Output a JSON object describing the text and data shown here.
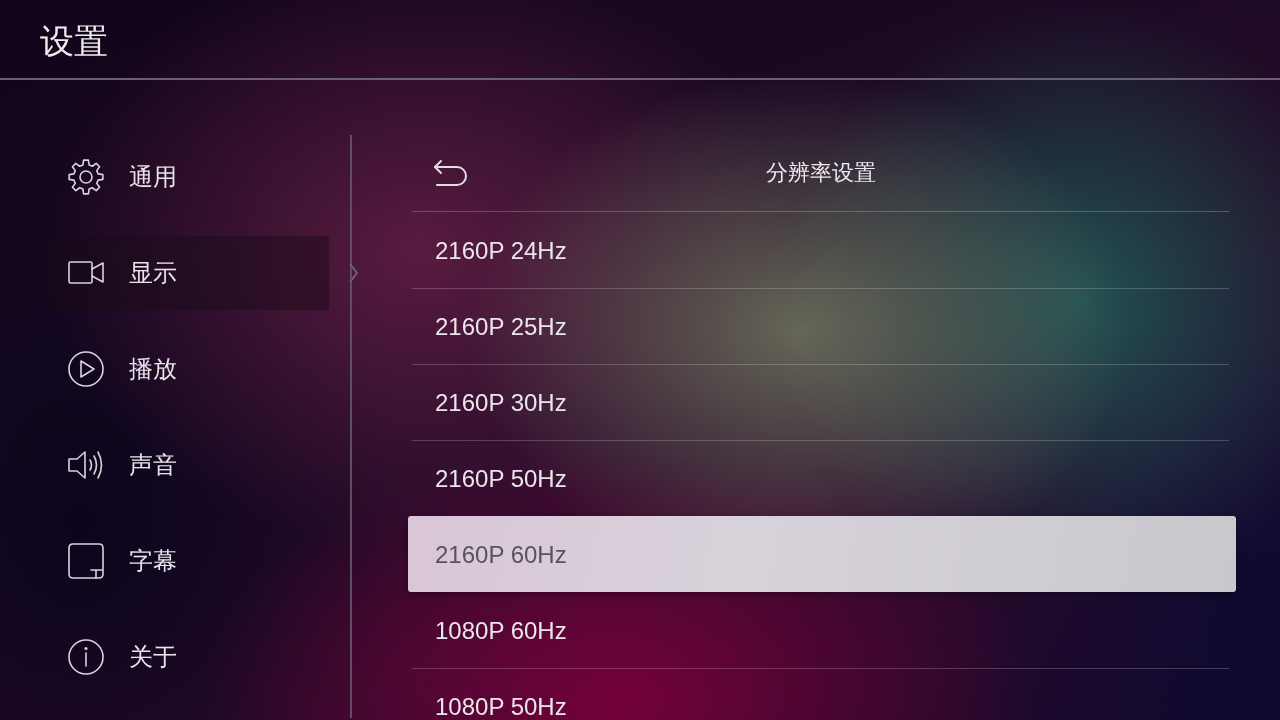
{
  "header": {
    "title": "设置"
  },
  "sidebar": {
    "items": [
      {
        "label": "通用",
        "selected": false
      },
      {
        "label": "显示",
        "selected": true
      },
      {
        "label": "播放",
        "selected": false
      },
      {
        "label": "声音",
        "selected": false
      },
      {
        "label": "字幕",
        "selected": false
      },
      {
        "label": "关于",
        "selected": false
      }
    ]
  },
  "panel": {
    "title": "分辨率设置",
    "options": [
      {
        "label": "2160P 24Hz",
        "selected": false
      },
      {
        "label": "2160P 25Hz",
        "selected": false
      },
      {
        "label": "2160P 30Hz",
        "selected": false
      },
      {
        "label": "2160P 50Hz",
        "selected": false
      },
      {
        "label": "2160P 60Hz",
        "selected": true
      },
      {
        "label": "1080P 60Hz",
        "selected": false
      },
      {
        "label": "1080P 50Hz",
        "selected": false
      }
    ]
  }
}
